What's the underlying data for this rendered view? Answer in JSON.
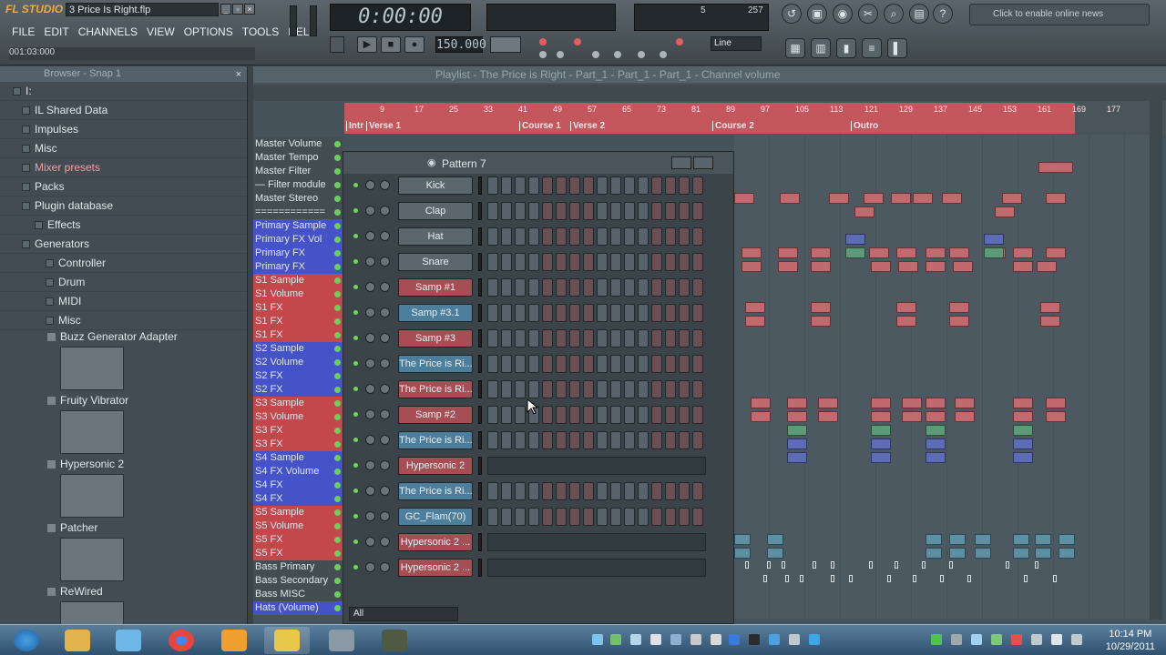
{
  "app": {
    "logo": "FL STUDIO",
    "filename": "3 Price Is Right.flp",
    "hint": "001:03:000"
  },
  "menu": [
    "FILE",
    "EDIT",
    "CHANNELS",
    "VIEW",
    "OPTIONS",
    "TOOLS",
    "HELP"
  ],
  "transport": {
    "time": "0:00:00",
    "tempo": "150.000",
    "mode_label": "Line",
    "pattern_counter": "5",
    "cpu": "257"
  },
  "news": "Click to enable online news",
  "browser": {
    "title": "Browser - Snap 1",
    "items": [
      {
        "label": "I:",
        "red": false
      },
      {
        "label": "IL Shared Data",
        "red": false
      },
      {
        "label": "Impulses",
        "red": false
      },
      {
        "label": "Misc",
        "red": false
      },
      {
        "label": "Mixer presets",
        "red": true
      },
      {
        "label": "Packs",
        "red": false
      },
      {
        "label": "Plugin database",
        "red": false
      },
      {
        "label": "Effects",
        "red": false
      },
      {
        "label": "Generators",
        "red": false
      },
      {
        "label": "Controller",
        "red": false
      },
      {
        "label": "Drum",
        "red": false
      },
      {
        "label": "MIDI",
        "red": false
      },
      {
        "label": "Misc",
        "red": false
      }
    ],
    "plugins": [
      "Buzz Generator Adapter",
      "Fruity Vibrator",
      "Hypersonic 2",
      "Patcher",
      "ReWired"
    ]
  },
  "playlist": {
    "title": "Playlist - The Price is Right - Part_1 - Part_1 - Part_1 - Channel volume",
    "ruler_ticks": [
      "9",
      "17",
      "25",
      "33",
      "41",
      "49",
      "57",
      "65",
      "73",
      "81",
      "89",
      "97",
      "105",
      "113",
      "121",
      "129",
      "137",
      "145",
      "153",
      "161",
      "169",
      "177"
    ],
    "markers": [
      "Intr",
      "Verse 1",
      "Course 1",
      "Verse 2",
      "Course 2",
      "Outro"
    ],
    "tracks": [
      {
        "label": "Master Volume",
        "color": "grey"
      },
      {
        "label": "Master Tempo",
        "color": "grey"
      },
      {
        "label": "Master Filter",
        "color": "grey"
      },
      {
        "label": "— Filter module",
        "color": "grey"
      },
      {
        "label": "Master Stereo",
        "color": "grey"
      },
      {
        "label": "============",
        "color": "grey"
      },
      {
        "label": "Primary Sample",
        "color": "blue"
      },
      {
        "label": "Primary FX Vol",
        "color": "blue"
      },
      {
        "label": "Primary FX",
        "color": "blue"
      },
      {
        "label": "Primary FX",
        "color": "blue"
      },
      {
        "label": "S1 Sample",
        "color": "red"
      },
      {
        "label": "S1 Volume",
        "color": "red"
      },
      {
        "label": "S1 FX",
        "color": "red"
      },
      {
        "label": "S1 FX",
        "color": "red"
      },
      {
        "label": "S1 FX",
        "color": "red"
      },
      {
        "label": "S2 Sample",
        "color": "blue"
      },
      {
        "label": "S2 Volume",
        "color": "blue"
      },
      {
        "label": "S2 FX",
        "color": "blue"
      },
      {
        "label": "S2 FX",
        "color": "blue"
      },
      {
        "label": "S3 Sample",
        "color": "red"
      },
      {
        "label": "S3 Volume",
        "color": "red"
      },
      {
        "label": "S3 FX",
        "color": "red"
      },
      {
        "label": "S3 FX",
        "color": "red"
      },
      {
        "label": "S4 Sample",
        "color": "blue"
      },
      {
        "label": "S4 FX Volume",
        "color": "blue"
      },
      {
        "label": "S4 FX",
        "color": "blue"
      },
      {
        "label": "S4 FX",
        "color": "blue"
      },
      {
        "label": "S5 Sample",
        "color": "red"
      },
      {
        "label": "S5 Volume",
        "color": "red"
      },
      {
        "label": "S5 FX",
        "color": "red"
      },
      {
        "label": "S5 FX",
        "color": "red"
      },
      {
        "label": "Bass Primary",
        "color": "grey"
      },
      {
        "label": "Bass Secondary",
        "color": "grey"
      },
      {
        "label": "Bass MISC",
        "color": "grey"
      },
      {
        "label": "Hats (Volume)",
        "color": "blue"
      }
    ]
  },
  "stepseq": {
    "pattern": "Pattern 7",
    "filter": "All",
    "channels": [
      {
        "label": "Kick",
        "type": "steps",
        "color": "grey"
      },
      {
        "label": "Clap",
        "type": "steps",
        "color": "grey"
      },
      {
        "label": "Hat",
        "type": "steps",
        "color": "grey"
      },
      {
        "label": "Snare",
        "type": "steps",
        "color": "grey"
      },
      {
        "label": "Samp #1",
        "type": "steps",
        "color": "red"
      },
      {
        "label": "Samp #3.1",
        "type": "steps",
        "color": "blue"
      },
      {
        "label": "Samp #3",
        "type": "steps",
        "color": "red"
      },
      {
        "label": "The Price is Ri...",
        "type": "steps",
        "color": "blue"
      },
      {
        "label": "The Price is Ri...",
        "type": "steps",
        "color": "red"
      },
      {
        "label": "Samp #2",
        "type": "steps",
        "color": "red"
      },
      {
        "label": "The Price is Ri...",
        "type": "steps",
        "color": "blue"
      },
      {
        "label": "Hypersonic 2",
        "type": "roll",
        "color": "red"
      },
      {
        "label": "The Price is Ri...",
        "type": "steps",
        "color": "blue"
      },
      {
        "label": "GC_Flam(70)",
        "type": "steps",
        "color": "blue"
      },
      {
        "label": "Hypersonic 2 ...",
        "type": "roll",
        "color": "red"
      },
      {
        "label": "Hypersonic 2 ...",
        "type": "roll",
        "color": "red"
      }
    ]
  },
  "taskbar": {
    "time": "10:14 PM",
    "date": "10/29/2011"
  }
}
